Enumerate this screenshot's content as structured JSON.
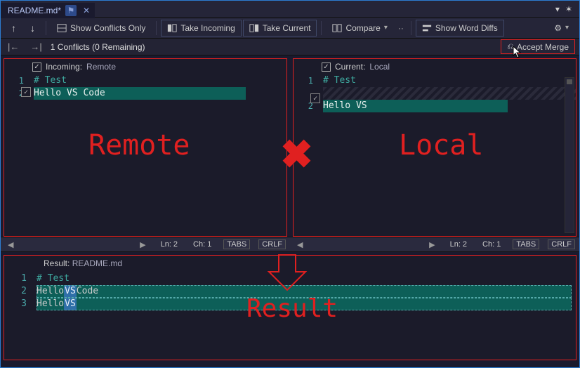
{
  "tab": {
    "title": "README.md*",
    "pin_glyph": "⚑",
    "close_glyph": "✕"
  },
  "window": {
    "dropdown_glyph": "▾",
    "gear_glyph": "✶"
  },
  "toolbar": {
    "up_glyph": "↑",
    "down_glyph": "↓",
    "show_conflicts": "Show Conflicts Only",
    "take_incoming": "Take Incoming",
    "take_current": "Take Current",
    "compare": "Compare",
    "overflow_glyph": "··",
    "show_word_diffs": "Show Word Diffs",
    "settings_glyph": "⚙"
  },
  "conflicts": {
    "prev_glyph": "|←",
    "next_glyph": "→|",
    "text": "1 Conflicts (0 Remaining)",
    "accept_merge": "Accept Merge",
    "merge_icon_glyph": "⎌"
  },
  "panes": {
    "incoming": {
      "check_glyph": "✓",
      "title": "Incoming:",
      "subtitle": "Remote",
      "line1_num": "1",
      "line1_text": "# Test",
      "line2_num": "2",
      "line2_check": "✓",
      "line2_text": "Hello VS Code",
      "annotation": "Remote"
    },
    "current": {
      "check_glyph": "✓",
      "title": "Current:",
      "subtitle": "Local",
      "line1_num": "1",
      "line1_text": "# Test",
      "line2_num": "2",
      "line2_check": "✓",
      "line2_text": "Hello VS",
      "annotation": "Local"
    },
    "cross_glyph": "✖"
  },
  "status": {
    "left": {
      "tri_l": "◀",
      "tri_r": "▶",
      "ln": "Ln: 2",
      "ch": "Ch: 1",
      "tabs": "TABS",
      "crlf": "CRLF"
    },
    "right": {
      "tri_l": "◀",
      "tri_r": "▶",
      "ln": "Ln: 2",
      "ch": "Ch: 1",
      "tabs": "TABS",
      "crlf": "CRLF"
    }
  },
  "result": {
    "header_label": "Result:",
    "header_file": "README.md",
    "line1_num": "1",
    "line1_text": "# Test",
    "line2_num": "2",
    "line2_pre": "Hello ",
    "line2_tok": "VS",
    "line2_post": " Code",
    "line3_num": "3",
    "line3_pre": "Hello ",
    "line3_tok": "VS",
    "annotation": "Result"
  }
}
